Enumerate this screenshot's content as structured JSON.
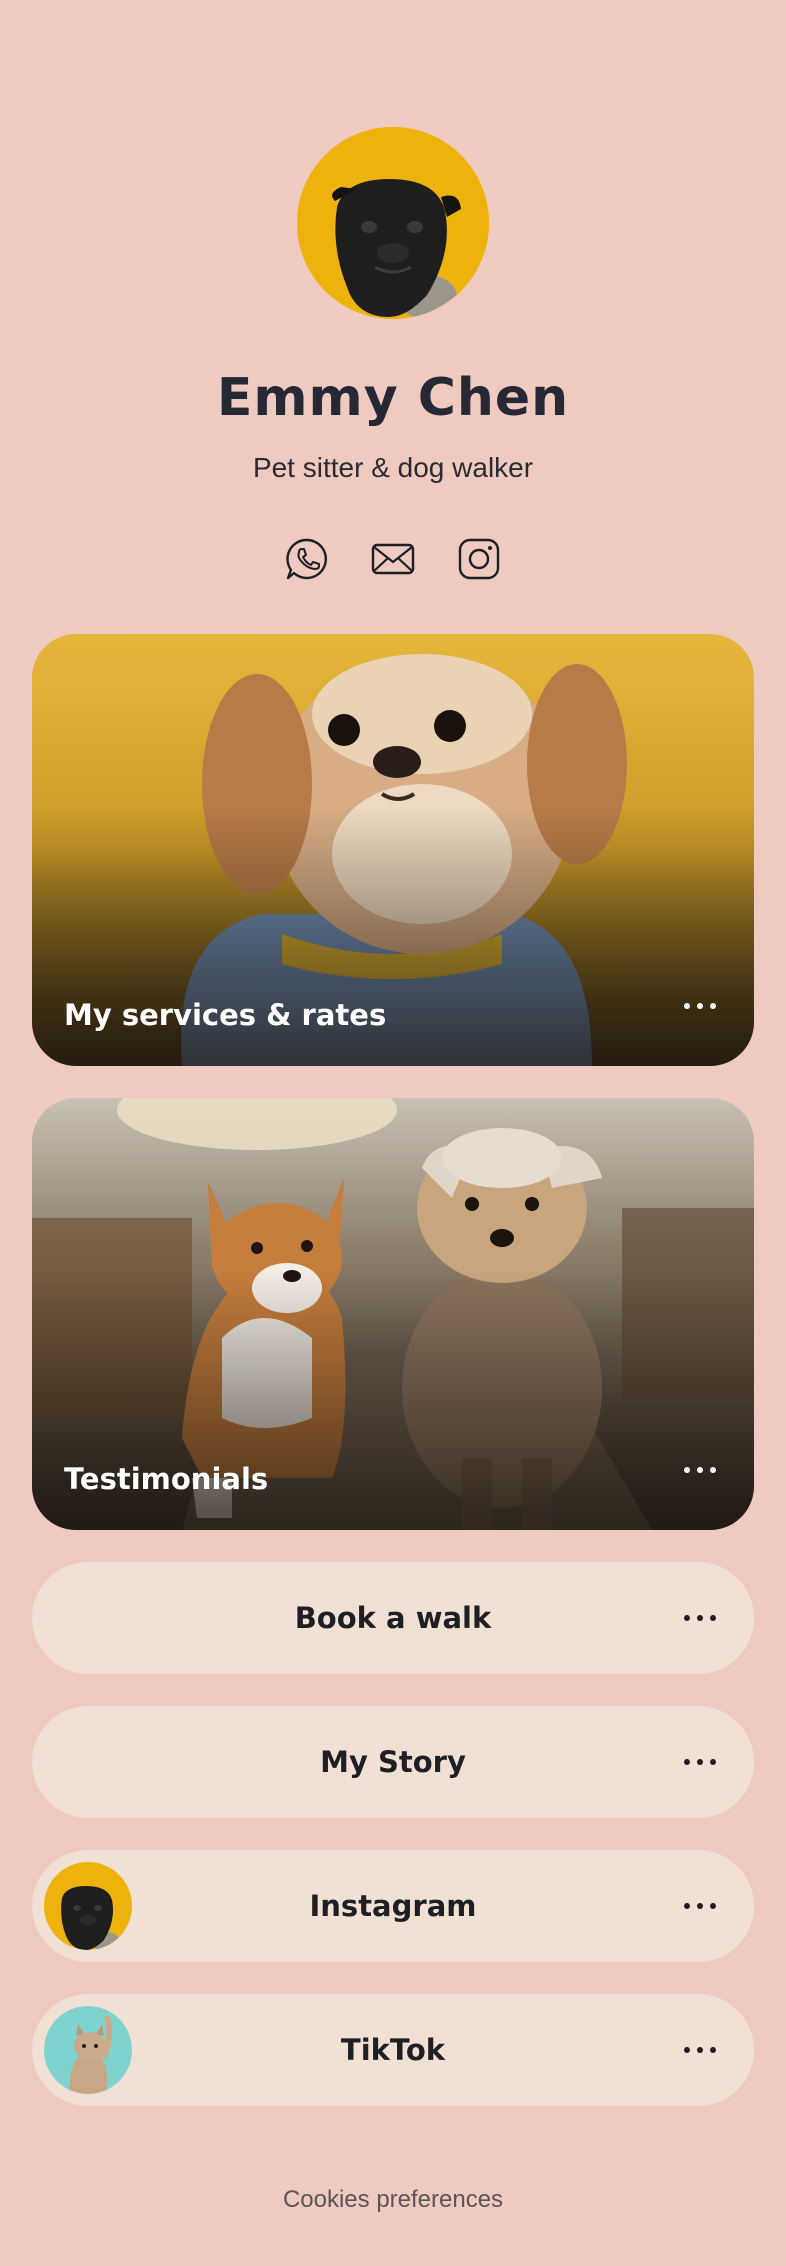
{
  "profile": {
    "name": "Emmy Chen",
    "tagline": "Pet sitter & dog walker",
    "avatar_icon": "pug-photo",
    "avatar_bg": "#eeb20d"
  },
  "socials": [
    {
      "icon": "whatsapp-icon"
    },
    {
      "icon": "email-icon"
    },
    {
      "icon": "instagram-icon"
    }
  ],
  "cards": [
    {
      "label": "My services & rates",
      "image": "dog-in-banana-shirt-photo"
    },
    {
      "label": "Testimonials",
      "image": "corgi-and-terrier-photo"
    }
  ],
  "links": [
    {
      "label": "Book a walk"
    },
    {
      "label": "My Story"
    },
    {
      "label": "Instagram",
      "thumb": "pug-photo"
    },
    {
      "label": "TikTok",
      "thumb": "cat-photo"
    }
  ],
  "footer": {
    "label": "Cookies preferences"
  },
  "colors": {
    "background": "#eecac0",
    "pill": "#f1e1d5",
    "accent_yellow": "#eeb20d",
    "text": "#23232b"
  }
}
